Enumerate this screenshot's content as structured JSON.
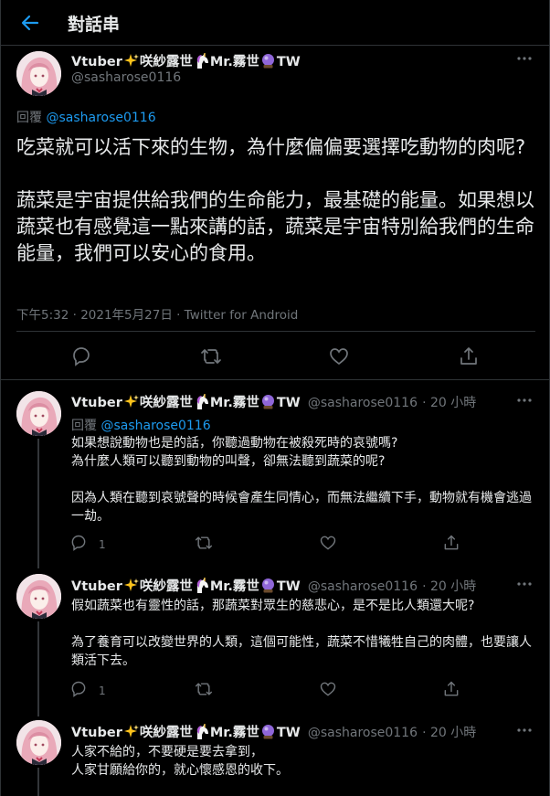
{
  "header": {
    "title": "對話串"
  },
  "author": {
    "name_part1": "Vtuber",
    "name_part2": "咲紗露世",
    "name_part3": "Mr.霧世",
    "name_part4": "TW",
    "handle": "@sasharose0116"
  },
  "main_tweet": {
    "reply_prefix": "回覆",
    "reply_handle": "@sasharose0116",
    "paragraphs": [
      "吃菜就可以活下來的生物，為什麼偏偏要選擇吃動物的肉呢?",
      "蔬菜是宇宙提供給我們的生命能力，最基礎的能量。如果想以蔬菜也有感覺這一點來講的話，蔬菜是宇宙特別給我們的生命能量，我們可以安心的食用。"
    ],
    "meta": "下午5:32 · 2021年5月27日 · Twitter for Android"
  },
  "replies": [
    {
      "handle": "@sasharose0116",
      "time": "· 20 小時",
      "reply_prefix": "回覆",
      "reply_handle": "@sasharose0116",
      "line1": "如果想說動物也是的話，你聽過動物在被殺死時的哀號嗎?",
      "line2": "為什麼人類可以聽到動物的叫聲，卻無法聽到蔬菜的呢?",
      "line3": "因為人類在聽到哀號聲的時候會產生同情心，而無法繼續下手，動物就有機會逃過一劫。",
      "reply_count": "1"
    },
    {
      "handle": "@sasharose0116",
      "time": "· 20 小時",
      "line1": "假如蔬菜也有靈性的話，那蔬菜對眾生的慈悲心，是不是比人類還大呢?",
      "line2": "為了養育可以改變世界的人類，這個可能性，蔬菜不惜犧牲自己的肉體，也要讓人類活下去。",
      "reply_count": "1"
    },
    {
      "handle": "@sasharose0116",
      "time": "· 20 小時",
      "line1": "人家不給的，不要硬是要去拿到，",
      "line2": "人家甘願給你的，就心懷感恩的收下。"
    }
  ],
  "colors": {
    "accent": "#1d9bf0",
    "background": "#000000",
    "muted": "#71767b"
  },
  "icons": [
    "back-arrow-icon",
    "more-icon",
    "reply-icon",
    "retweet-icon",
    "like-icon",
    "share-icon",
    "sparkles-icon",
    "unicorn-icon",
    "crystal-ball-icon"
  ]
}
